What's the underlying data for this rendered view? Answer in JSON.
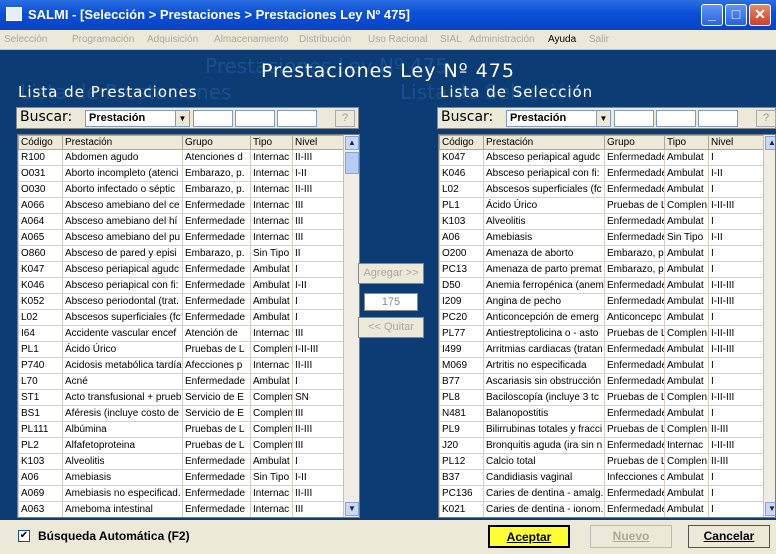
{
  "window": {
    "title": "SALMI - [Selección > Prestaciones > Prestaciones Ley Nº 475]"
  },
  "menu": [
    "Selección",
    "Programación",
    "Adquisición",
    "Almacenamiento",
    "Distribución",
    "Uso Racional",
    "SIAL",
    "Administración",
    "Ayuda",
    "Salir"
  ],
  "page_title": "Prestaciones Ley Nº 475",
  "left": {
    "title": "Lista de Prestaciones",
    "search_label": "Buscar:",
    "search_field": "Prestación",
    "help": "?"
  },
  "right": {
    "title": "Lista de Selección",
    "search_label": "Buscar:",
    "search_field": "Prestación",
    "help": "?"
  },
  "columns": [
    "Código",
    "Prestación",
    "Grupo",
    "Tipo",
    "Nivel"
  ],
  "left_rows": [
    [
      "R100",
      "Abdomen agudo",
      "Atenciones d",
      "Internac",
      "II-III"
    ],
    [
      "O031",
      "Aborto incompleto (atenci",
      "Embarazo, p.",
      "Internac",
      "I-II"
    ],
    [
      "O030",
      "Aborto infectado o séptic",
      "Embarazo, p.",
      "Internac",
      "II-III"
    ],
    [
      "A066",
      "Absceso amebiano del ce",
      "Enfermedade",
      "Internac",
      "III"
    ],
    [
      "A064",
      "Absceso amebiano del hí",
      "Enfermedade",
      "Internac",
      "III"
    ],
    [
      "A065",
      "Absceso amebiano del pu",
      "Enfermedade",
      "Internac",
      "III"
    ],
    [
      "O860",
      "Absceso de pared y episi",
      "Embarazo, p.",
      "Sin Tipo",
      "II"
    ],
    [
      "K047",
      "Absceso periapical agudc",
      "Enfermedade",
      "Ambulat",
      "I"
    ],
    [
      "K046",
      "Absceso periapical con fi:",
      "Enfermedade",
      "Ambulat",
      "I-II"
    ],
    [
      "K052",
      "Absceso periodontal (trat.",
      "Enfermedade",
      "Ambulat",
      "I"
    ],
    [
      "L02",
      "Abscesos superficiales (fc",
      "Enfermedade",
      "Ambulat",
      "I"
    ],
    [
      "I64",
      "Accidente vascular encef",
      "Atención de",
      "Internac",
      "III"
    ],
    [
      "PL1",
      "Ácido Úrico",
      "Pruebas de L",
      "Complen",
      "I-II-III"
    ],
    [
      "P740",
      "Acidosis metabólica tardía",
      "Afecciones p",
      "Internac",
      "II-III"
    ],
    [
      "L70",
      "Acné",
      "Enfermedade",
      "Ambulat",
      "I"
    ],
    [
      "ST1",
      "Acto transfusional + prueb",
      "Servicio de E",
      "Complen",
      "SN"
    ],
    [
      "BS1",
      "Aféresis (incluye costo de",
      "Servicio de E",
      "Complen",
      "III"
    ],
    [
      "PL111",
      "Albúmina",
      "Pruebas de L",
      "Complen",
      "II-III"
    ],
    [
      "PL2",
      "Alfafetoproteina",
      "Pruebas de L",
      "Complen",
      "III"
    ],
    [
      "K103",
      "Alveolitis",
      "Enfermedade",
      "Ambulat",
      "I"
    ],
    [
      "A06",
      "Amebiasis",
      "Enfermedade",
      "Sin Tipo",
      "I-II"
    ],
    [
      "A069",
      "Amebiasis no especificad.",
      "Enfermedade",
      "Internac",
      "II-III"
    ],
    [
      "A063",
      "Ameboma intestinal",
      "Enfermedade",
      "Internac",
      "III"
    ]
  ],
  "right_rows": [
    [
      "K047",
      "Absceso periapical agudc",
      "Enfermedade",
      "Ambulat",
      "I"
    ],
    [
      "K046",
      "Absceso periapical con fi:",
      "Enfermedade",
      "Ambulat",
      "I-II"
    ],
    [
      "L02",
      "Abscesos superficiales (fc",
      "Enfermedade",
      "Ambulat",
      "I"
    ],
    [
      "PL1",
      "Ácido Úrico",
      "Pruebas de L",
      "Complen",
      "I-II-III"
    ],
    [
      "K103",
      "Alveolitis",
      "Enfermedade",
      "Ambulat",
      "I"
    ],
    [
      "A06",
      "Amebiasis",
      "Enfermedade",
      "Sin Tipo",
      "I-II"
    ],
    [
      "O200",
      "Amenaza de aborto",
      "Embarazo, p.",
      "Ambulat",
      "I"
    ],
    [
      "PC13",
      "Amenaza de parto premat",
      "Embarazo, p.",
      "Ambulat",
      "I"
    ],
    [
      "D50",
      "Anemia ferropénica (anem",
      "Enfermedade",
      "Ambulat",
      "I-II-III"
    ],
    [
      "I209",
      "Angina de pecho",
      "Enfermedade",
      "Ambulat",
      "I-II-III"
    ],
    [
      "PC20",
      "Anticoncepción de emerg",
      "Anticoncepc",
      "Ambulat",
      "I"
    ],
    [
      "PL77",
      "Antiestreptolicina o - asto",
      "Pruebas de L",
      "Complen",
      "I-II-III"
    ],
    [
      "I499",
      "Arritmias cardiacas (tratan",
      "Enfermedade",
      "Ambulat",
      "I-II-III"
    ],
    [
      "M069",
      "Artritis no especificada",
      "Enfermedade",
      "Ambulat",
      "I"
    ],
    [
      "B77",
      "Ascariasis sin obstrucción",
      "Enfermedade",
      "Ambulat",
      "I"
    ],
    [
      "PL8",
      "Baciloscopía (incluye 3 tc",
      "Pruebas de L",
      "Complen",
      "I-II-III"
    ],
    [
      "N481",
      "Balanopostitis",
      "Enfermedade",
      "Ambulat",
      "I"
    ],
    [
      "PL9",
      "Bilirrubinas totales y fracci",
      "Pruebas de L",
      "Complen",
      "II-III"
    ],
    [
      "J20",
      "Bronquitis aguda (ira sin n",
      "Enfermedade",
      "Internac",
      "I-II-III"
    ],
    [
      "PL12",
      "Calcio total",
      "Pruebas de L",
      "Complen",
      "II-III"
    ],
    [
      "B37",
      "Candidiasis vaginal",
      "Infecciones c",
      "Ambulat",
      "I"
    ],
    [
      "PC136",
      "Caries de dentina - amalg.",
      "Enfermedade",
      "Ambulat",
      "I"
    ],
    [
      "K021",
      "Caries de dentina - ionom.",
      "Enfermedade",
      "Ambulat",
      "I"
    ]
  ],
  "middle": {
    "add": "Agregar >>",
    "count": "175",
    "remove": "<< Quitar"
  },
  "footer": {
    "auto_search": "Búsqueda Automática (F2)",
    "accept": "Aceptar",
    "new": "Nuevo",
    "cancel": "Cancelar"
  }
}
